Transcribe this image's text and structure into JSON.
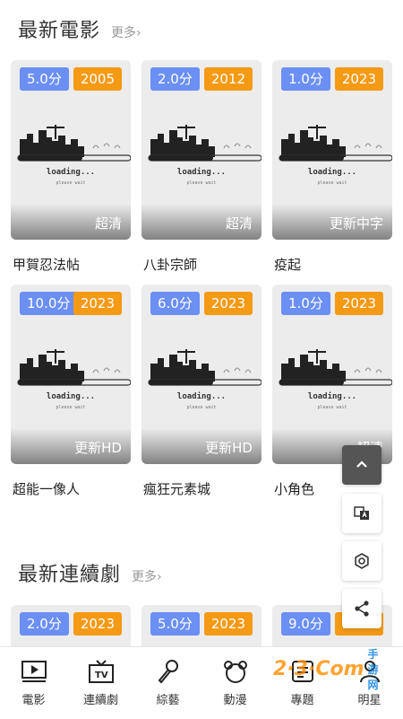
{
  "sections": {
    "movies": {
      "title": "最新電影",
      "more": "更多›"
    },
    "series": {
      "title": "最新連續劇",
      "more": "更多›"
    }
  },
  "movies": [
    {
      "score": "5.0分",
      "year": "2005",
      "quality": "超清",
      "title": "甲賀忍法帖"
    },
    {
      "score": "2.0分",
      "year": "2012",
      "quality": "超清",
      "title": "八卦宗師"
    },
    {
      "score": "1.0分",
      "year": "2023",
      "quality": "更新中字",
      "title": "疫起"
    },
    {
      "score": "10.0分",
      "year": "2023",
      "quality": "更新HD",
      "title": "超能一像人"
    },
    {
      "score": "6.0分",
      "year": "2023",
      "quality": "更新HD",
      "title": "瘋狂元素城"
    },
    {
      "score": "1.0分",
      "year": "2023",
      "quality": "超清",
      "title": "小角色"
    }
  ],
  "series": [
    {
      "score": "2.0分",
      "year": "2023"
    },
    {
      "score": "5.0分",
      "year": "2023"
    },
    {
      "score": "9.0分",
      "year": "2023"
    }
  ],
  "loading": {
    "text": "loading...",
    "sub": "please wait"
  },
  "tabs": [
    {
      "label": "電影",
      "icon": "movie-icon"
    },
    {
      "label": "連續劇",
      "icon": "tv-icon"
    },
    {
      "label": "綜藝",
      "icon": "microphone-icon"
    },
    {
      "label": "動漫",
      "icon": "anime-icon"
    },
    {
      "label": "專題",
      "icon": "topic-icon"
    },
    {
      "label": "明星",
      "icon": "star-person-icon"
    }
  ],
  "watermark": {
    "brand": "2·3·Com",
    "sub": "手游网"
  },
  "colors": {
    "score_badge": "#6b8ff3",
    "year_badge": "#f59a14"
  }
}
